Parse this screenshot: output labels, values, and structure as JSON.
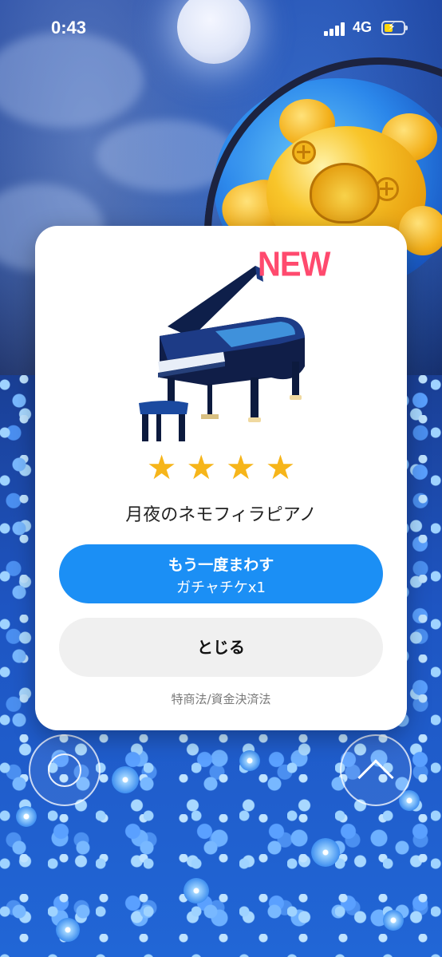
{
  "status_bar": {
    "time": "0:43",
    "network": "4G",
    "battery_level": 0.45,
    "battery_color": "#ffd60a"
  },
  "modal": {
    "badge": "NEW",
    "item_image": "grand-piano-icon",
    "rating_stars": 4,
    "item_name": "月夜のネモフィラピアノ",
    "primary_button": {
      "line1": "もう一度まわす",
      "line2": "ガチャチケx1"
    },
    "secondary_button": "とじる",
    "legal_link": "特商法/資金決済法"
  },
  "colors": {
    "primary": "#1b8ff5",
    "badge": "#ff4a6e",
    "star": "#f6b51a"
  },
  "side_buttons": {
    "left_icon": "circle-icon",
    "right_icon": "chevron-up-icon"
  }
}
